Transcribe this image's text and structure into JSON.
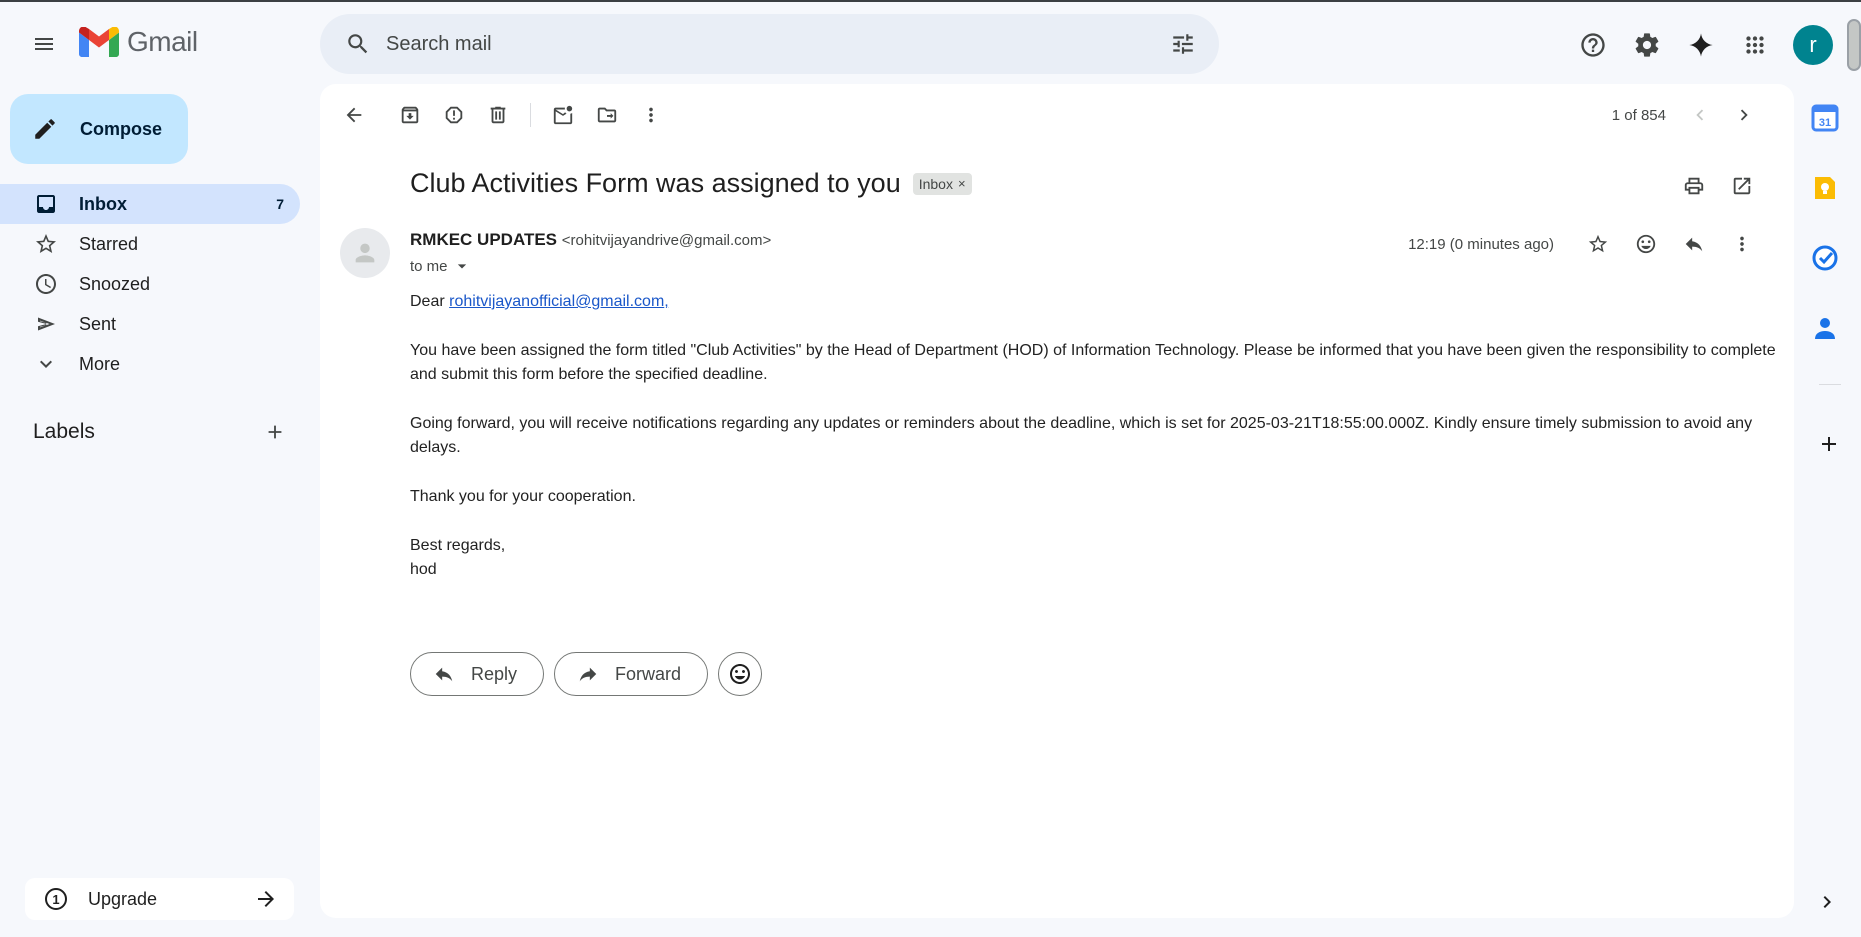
{
  "app": {
    "name": "Gmail"
  },
  "search": {
    "placeholder": "Search mail"
  },
  "compose": {
    "label": "Compose"
  },
  "nav": [
    {
      "label": "Inbox",
      "count": "7",
      "icon": "inbox-icon",
      "active": true
    },
    {
      "label": "Starred",
      "count": "",
      "icon": "star-icon"
    },
    {
      "label": "Snoozed",
      "count": "",
      "icon": "clock-icon"
    },
    {
      "label": "Sent",
      "count": "",
      "icon": "send-icon"
    },
    {
      "label": "More",
      "count": "",
      "icon": "chevron-down-icon"
    }
  ],
  "labels": {
    "title": "Labels"
  },
  "upgrade": {
    "label": "Upgrade",
    "icon_text": "1"
  },
  "account": {
    "avatar_letter": "r",
    "avatar_color": "#00838f"
  },
  "pager": {
    "text": "1 of 854"
  },
  "email": {
    "subject": "Club Activities Form was assigned to you",
    "label_chip": "Inbox",
    "chip_close": "×",
    "sender_name": "RMKEC UPDATES",
    "sender_email": "<rohitvijayandrive@gmail.com>",
    "to": "to me",
    "time": "12:19 (0 minutes ago)",
    "greeting": "Dear",
    "recipient_link": "rohitvijayanofficial@gmail.com",
    "recipient_suffix": ",",
    "paragraphs": [
      "You have been assigned the form titled \"Club Activities\" by the Head of Department (HOD) of Information Technology. Please be informed that you have been given the responsibility to complete and submit this form before the specified deadline.",
      "Going forward, you will receive notifications regarding any updates or reminders about the deadline, which is set for 2025-03-21T18:55:00.000Z. Kindly ensure timely submission to avoid any delays.",
      "Thank you for your cooperation."
    ],
    "closing": "Best regards,",
    "signature": "hod"
  },
  "reply_actions": {
    "reply": "Reply",
    "forward": "Forward"
  },
  "side_panel": {
    "calendar_day": "31"
  },
  "colors": {
    "background": "#f6f8fc",
    "compose_bg": "#c2e7ff",
    "active_nav_bg": "#d3e3fd",
    "link": "#1a57c9"
  }
}
